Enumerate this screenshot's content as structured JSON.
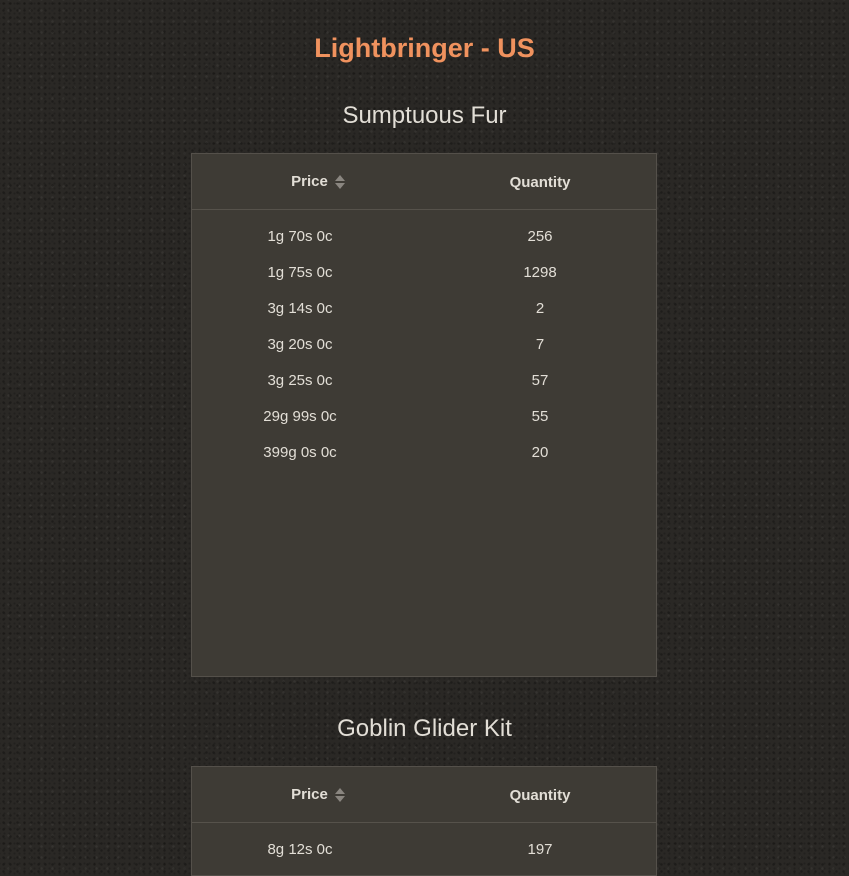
{
  "header": {
    "title": "Lightbringer - US"
  },
  "sections": [
    {
      "title": "Sumptuous Fur",
      "columns": {
        "price": "Price",
        "quantity": "Quantity"
      },
      "rows": [
        {
          "price": "1g 70s 0c",
          "quantity": "256"
        },
        {
          "price": "1g 75s 0c",
          "quantity": "1298"
        },
        {
          "price": "3g 14s 0c",
          "quantity": "2"
        },
        {
          "price": "3g 20s 0c",
          "quantity": "7"
        },
        {
          "price": "3g 25s 0c",
          "quantity": "57"
        },
        {
          "price": "29g 99s 0c",
          "quantity": "55"
        },
        {
          "price": "399g 0s 0c",
          "quantity": "20"
        }
      ]
    },
    {
      "title": "Goblin Glider Kit",
      "columns": {
        "price": "Price",
        "quantity": "Quantity"
      },
      "rows": [
        {
          "price": "8g 12s 0c",
          "quantity": "197"
        }
      ]
    }
  ],
  "colors": {
    "accent": "#f0925e",
    "panel": "#3e3b35",
    "background": "#2a2825"
  },
  "icons": {
    "sort": "sort-both-icon"
  }
}
